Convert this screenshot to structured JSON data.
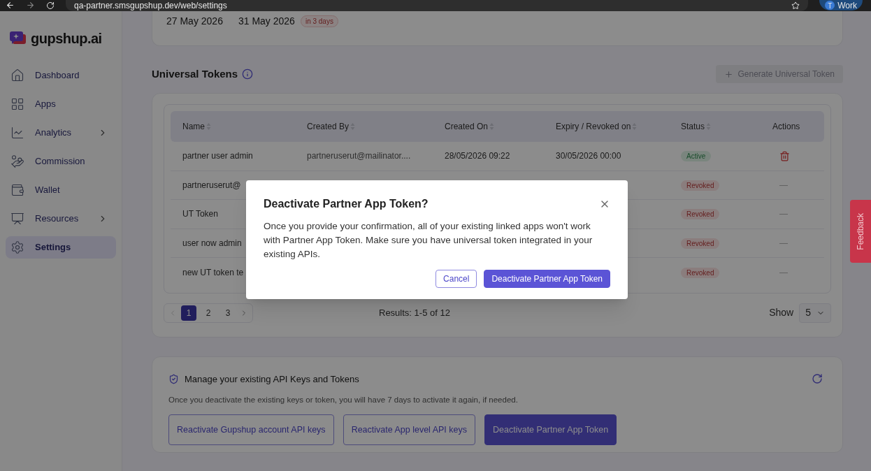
{
  "browser": {
    "url": "qa-partner.smsgupshup.dev/web/settings",
    "profile_initial": "T",
    "profile": "Work"
  },
  "sidebar": {
    "logo": "gupshup.ai",
    "items": [
      {
        "label": "Dashboard",
        "selected": false,
        "expandable": false
      },
      {
        "label": "Apps",
        "selected": false,
        "expandable": false
      },
      {
        "label": "Analytics",
        "selected": false,
        "expandable": true
      },
      {
        "label": "Commission",
        "selected": false,
        "expandable": false
      },
      {
        "label": "Wallet",
        "selected": false,
        "expandable": false
      },
      {
        "label": "Resources",
        "selected": false,
        "expandable": true
      },
      {
        "label": "Settings",
        "selected": true,
        "expandable": false
      }
    ]
  },
  "secret_card": {
    "dates": [
      "27 May 2026",
      "31 May 2026"
    ],
    "badge": "in 3 days"
  },
  "universal_tokens": {
    "title": "Universal Tokens",
    "generate_button": "Generate Universal Token",
    "columns": [
      {
        "label": "Name",
        "sortable": true
      },
      {
        "label": "Created By",
        "sortable": true
      },
      {
        "label": "Created On",
        "sortable": true
      },
      {
        "label": "Expiry / Revoked on",
        "sortable": true
      },
      {
        "label": "Status",
        "sortable": true
      },
      {
        "label": "Actions",
        "sortable": false
      }
    ],
    "rows": [
      {
        "cells": [
          "partner user admin",
          "partneruserut@mailinator....",
          "28/05/2026 09:22",
          "30/05/2026 00:00"
        ],
        "status": "Active",
        "kind": "active"
      },
      {
        "cells": [
          "partneruserut@"
        ],
        "status": "Revoked",
        "kind": "revoked",
        "action": "—"
      },
      {
        "cells": [
          "UT Token"
        ],
        "status": "Revoked",
        "kind": "revoked",
        "action": "—"
      },
      {
        "cells": [
          "user now admin"
        ],
        "status": "Revoked",
        "kind": "revoked",
        "action": "—"
      },
      {
        "cells": [
          "new UT token te"
        ],
        "status": "Revoked",
        "kind": "revoked",
        "action": "—"
      }
    ],
    "pagination": {
      "pages": [
        {
          "label": "1",
          "selected": true
        },
        {
          "label": "2",
          "selected": false
        },
        {
          "label": "3",
          "selected": false
        }
      ],
      "results": "Results: 1-5 of 12"
    },
    "show": {
      "label": "Show",
      "value": "5"
    }
  },
  "manage": {
    "title": "Manage your existing API Keys and Tokens",
    "description": "Once you deactivate the existing keys or token, you will have 7 days to activate it again, if needed.",
    "buttons": [
      {
        "label": "Reactivate Gupshup account API keys",
        "kind": "outline"
      },
      {
        "label": "Reactivate App level API keys",
        "kind": "outline"
      },
      {
        "label": "Deactivate Partner App Token",
        "kind": "primary"
      }
    ]
  },
  "feedback": "Feedback",
  "modal": {
    "title": "Deactivate Partner App Token?",
    "body": "Once you provide your confirmation, all of your existing linked apps won't work with Partner App Token. Make sure you have universal token integrated in your existing APIs.",
    "buttons": [
      {
        "label": "Cancel",
        "kind": "outline"
      },
      {
        "label": "Deactivate Partner App Token",
        "kind": "primary"
      }
    ]
  }
}
